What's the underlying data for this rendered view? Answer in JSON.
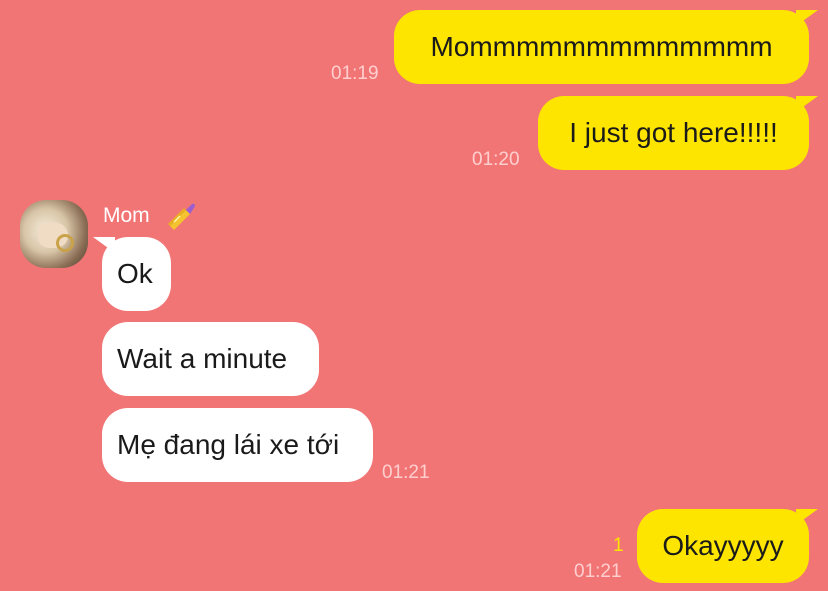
{
  "chat": {
    "contact_name": "Mom",
    "messages": [
      {
        "direction": "out",
        "text": "Mommmmmmmmmmmmm",
        "time": "01:19"
      },
      {
        "direction": "out",
        "text": "I just got here!!!!!",
        "time": "01:20"
      },
      {
        "direction": "in",
        "text": "Ok"
      },
      {
        "direction": "in",
        "text": "Wait a minute"
      },
      {
        "direction": "in",
        "text": "Mẹ đang lái xe tới",
        "time": "01:21"
      },
      {
        "direction": "out",
        "text": "Okayyyyy",
        "time": "01:21",
        "unread_count": "1"
      }
    ]
  },
  "colors": {
    "background": "#f27575",
    "outgoing_bubble": "#fee500",
    "incoming_bubble": "#ffffff",
    "timestamp": "#ffcfcf",
    "unread": "#fee500"
  },
  "icons": {
    "name_emoji": "nail-polish-icon",
    "avatar": "avatar-photo"
  }
}
